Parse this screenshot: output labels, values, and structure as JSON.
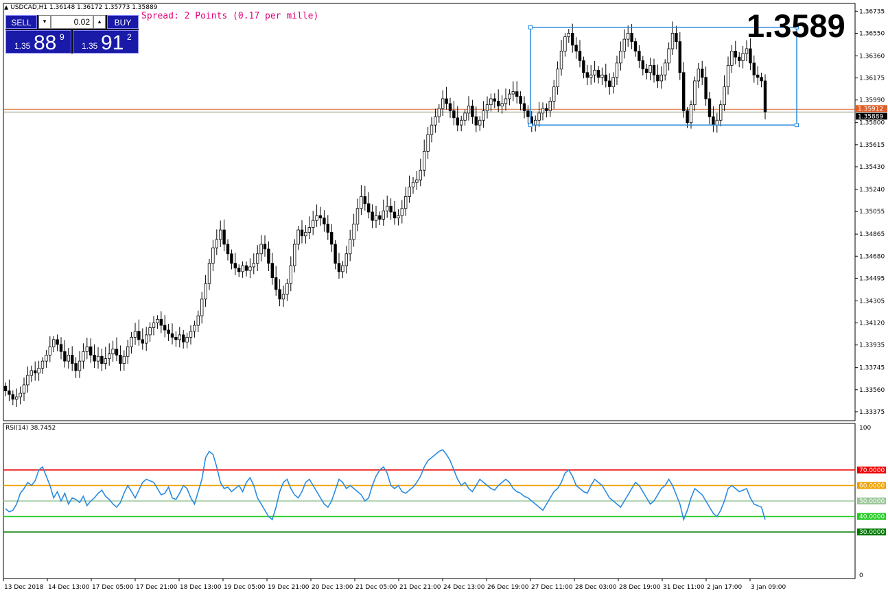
{
  "header": {
    "symbol_text": "USDCAD,H1  1.36148 1.36172 1.35773 1.35889",
    "spread_text": "Spread: 2 Points (0.17 per mille)",
    "big_price": "1.3589"
  },
  "trade_panel": {
    "sell_label": "SELL",
    "buy_label": "BUY",
    "lot_value": "0.02",
    "spin_down": "▾",
    "spin_up": "▴",
    "sell_prefix": "1.35",
    "sell_big": "88",
    "sell_sup": "9",
    "buy_prefix": "1.35",
    "buy_big": "91",
    "buy_sup": "2"
  },
  "rsi": {
    "title": "RSI(14) 38.7452"
  },
  "chart_data": [
    {
      "type": "candlestick",
      "symbol": "USDCAD",
      "timeframe": "H1",
      "ohlc_current": {
        "open": 1.36148,
        "high": 1.36172,
        "low": 1.35773,
        "close": 1.35889
      },
      "ylim": [
        1.333,
        1.368
      ],
      "y_ticks": [
        "1.36735",
        "1.36550",
        "1.36360",
        "1.36175",
        "1.35990",
        "1.35800",
        "1.35615",
        "1.35430",
        "1.35240",
        "1.35055",
        "1.34865",
        "1.34680",
        "1.34495",
        "1.34305",
        "1.34120",
        "1.33935",
        "1.33745",
        "1.33560",
        "1.33375"
      ],
      "x_tick_labels": [
        "13 Dec 2018",
        "14 Dec 13:00",
        "17 Dec 05:00",
        "17 Dec 21:00",
        "18 Dec 13:00",
        "19 Dec 05:00",
        "19 Dec 21:00",
        "20 Dec 13:00",
        "21 Dec 05:00",
        "21 Dec 21:00",
        "24 Dec 13:00",
        "26 Dec 19:00",
        "27 Dec 11:00",
        "28 Dec 03:00",
        "28 Dec 19:00",
        "31 Dec 11:00",
        "2 Jan 17:00",
        "3 Jan 09:00"
      ],
      "closes": [
        1.3355,
        1.3352,
        1.3348,
        1.335,
        1.3353,
        1.336,
        1.3368,
        1.3372,
        1.337,
        1.3374,
        1.338,
        1.3385,
        1.3392,
        1.3398,
        1.3394,
        1.3388,
        1.338,
        1.3385,
        1.3378,
        1.3372,
        1.338,
        1.3388,
        1.3392,
        1.3385,
        1.338,
        1.3384,
        1.3378,
        1.3382,
        1.3386,
        1.339,
        1.3385,
        1.3378,
        1.3384,
        1.3392,
        1.34,
        1.3405,
        1.3398,
        1.3395,
        1.3402,
        1.3408,
        1.3412,
        1.3415,
        1.341,
        1.3406,
        1.3403,
        1.34,
        1.3398,
        1.3402,
        1.3396,
        1.34,
        1.3405,
        1.341,
        1.3418,
        1.3432,
        1.3445,
        1.3462,
        1.3475,
        1.3482,
        1.349,
        1.3478,
        1.347,
        1.3462,
        1.3458,
        1.3455,
        1.346,
        1.3456,
        1.3459,
        1.3462,
        1.347,
        1.3478,
        1.3474,
        1.3462,
        1.345,
        1.344,
        1.3432,
        1.3436,
        1.3445,
        1.346,
        1.3478,
        1.349,
        1.3485,
        1.3488,
        1.3492,
        1.3498,
        1.3502,
        1.35,
        1.3495,
        1.3488,
        1.3478,
        1.3462,
        1.3455,
        1.346,
        1.347,
        1.3482,
        1.3495,
        1.3508,
        1.3518,
        1.3512,
        1.3505,
        1.3498,
        1.3502,
        1.3499,
        1.3506,
        1.351,
        1.3505,
        1.35,
        1.3502,
        1.3508,
        1.3518,
        1.3526,
        1.353,
        1.3532,
        1.354,
        1.3556,
        1.357,
        1.3578,
        1.3585,
        1.3592,
        1.36,
        1.3596,
        1.359,
        1.3584,
        1.3578,
        1.3582,
        1.3588,
        1.3594,
        1.3585,
        1.3578,
        1.3582,
        1.359,
        1.3595,
        1.36,
        1.3598,
        1.3594,
        1.3596,
        1.36,
        1.3604,
        1.3606,
        1.3602,
        1.3596,
        1.359,
        1.3585,
        1.3578,
        1.3582,
        1.3588,
        1.3592,
        1.359,
        1.3598,
        1.361,
        1.3625,
        1.364,
        1.3652,
        1.3655,
        1.3645,
        1.364,
        1.3632,
        1.3622,
        1.3618,
        1.362,
        1.3624,
        1.3618,
        1.362,
        1.3615,
        1.361,
        1.3618,
        1.363,
        1.364,
        1.365,
        1.3655,
        1.3648,
        1.364,
        1.3632,
        1.3625,
        1.3622,
        1.3628,
        1.362,
        1.3615,
        1.362,
        1.363,
        1.3642,
        1.3655,
        1.3648,
        1.3622,
        1.359,
        1.358,
        1.3595,
        1.3615,
        1.3625,
        1.3618,
        1.36,
        1.3585,
        1.3578,
        1.3582,
        1.3595,
        1.361,
        1.3628,
        1.364,
        1.3635,
        1.3632,
        1.3638,
        1.3642,
        1.363,
        1.362,
        1.3618,
        1.3615,
        1.3589
      ],
      "overlay_lines": [
        {
          "price": 1.35912,
          "color": "#e0602a",
          "label": "1.35912"
        },
        {
          "price": 1.35889,
          "color": "#9aa08a",
          "label": "1.35889"
        }
      ],
      "range_box": {
        "price_top": 1.366,
        "price_bottom": 1.3578,
        "color": "#2a8ae0"
      }
    },
    {
      "type": "line",
      "title": "RSI(14) 38.7452",
      "ylim": [
        0,
        100
      ],
      "y_ticks": [
        "100",
        "0"
      ],
      "levels": [
        {
          "value": 70,
          "label": "70.0000",
          "color": "#ee0000"
        },
        {
          "value": 60,
          "label": "60.0000",
          "color": "#f0a000"
        },
        {
          "value": 50,
          "label": "50.0000",
          "color": "#99c799"
        },
        {
          "value": 40,
          "label": "40.0000",
          "color": "#22cc22"
        },
        {
          "value": 30,
          "label": "30.0000",
          "color": "#007700"
        }
      ],
      "line_color": "#2a8ae0",
      "series": [
        {
          "values": [
            45,
            43,
            44,
            48,
            55,
            58,
            62,
            60,
            63,
            70,
            72,
            66,
            60,
            52,
            56,
            50,
            55,
            48,
            52,
            51,
            49,
            53,
            47,
            50,
            52,
            55,
            57,
            53,
            51,
            48,
            46,
            49,
            55,
            60,
            56,
            52,
            57,
            62,
            64,
            63,
            62,
            58,
            54,
            55,
            59,
            52,
            51,
            55,
            60,
            58,
            52,
            48,
            56,
            64,
            78,
            82,
            80,
            72,
            62,
            58,
            59,
            56,
            58,
            60,
            56,
            62,
            65,
            60,
            52,
            48,
            44,
            40,
            38,
            46,
            56,
            62,
            64,
            58,
            54,
            52,
            56,
            62,
            64,
            60,
            56,
            52,
            48,
            46,
            50,
            57,
            64,
            62,
            58,
            60,
            58,
            56,
            54,
            50,
            52,
            60,
            66,
            70,
            72,
            68,
            60,
            58,
            60,
            56,
            55,
            57,
            59,
            62,
            66,
            72,
            76,
            78,
            80,
            82,
            83,
            80,
            76,
            70,
            64,
            60,
            62,
            58,
            56,
            60,
            64,
            62,
            60,
            58,
            57,
            60,
            62,
            64,
            62,
            58,
            56,
            55,
            53,
            52,
            50,
            48,
            46,
            44,
            48,
            52,
            56,
            58,
            62,
            68,
            70,
            66,
            60,
            58,
            56,
            55,
            60,
            64,
            62,
            60,
            56,
            52,
            50,
            48,
            46,
            50,
            54,
            58,
            62,
            60,
            56,
            52,
            48,
            50,
            54,
            58,
            60,
            64,
            60,
            54,
            48,
            38,
            44,
            52,
            58,
            56,
            54,
            50,
            46,
            42,
            40,
            44,
            50,
            58,
            60,
            58,
            56,
            57,
            58,
            52,
            48,
            47,
            46,
            38
          ]
        }
      ]
    }
  ]
}
